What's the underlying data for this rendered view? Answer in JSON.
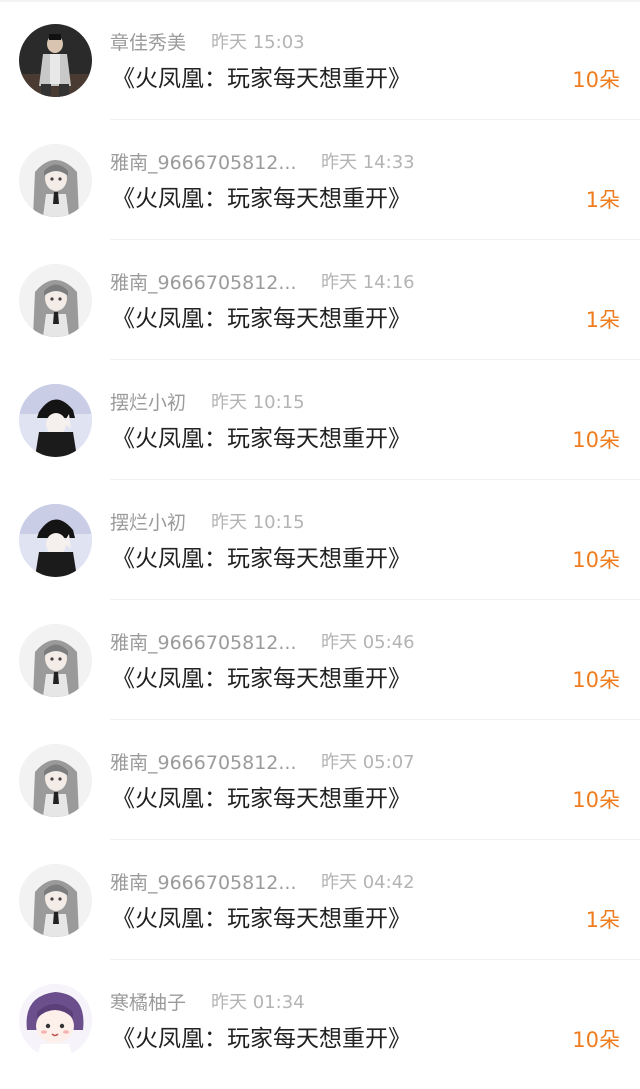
{
  "gifts": [
    {
      "user": "章佳秀美",
      "time": "昨天 15:03",
      "title": "《火凤凰：玩家每天想重开》",
      "amount": "10朵",
      "avatar": "avatar-dark-figure"
    },
    {
      "user": "雅南_9666705812...",
      "time": "昨天 14:33",
      "title": "《火凤凰：玩家每天想重开》",
      "amount": "1朵",
      "avatar": "avatar-grey-hair-girl"
    },
    {
      "user": "雅南_9666705812...",
      "time": "昨天 14:16",
      "title": "《火凤凰：玩家每天想重开》",
      "amount": "1朵",
      "avatar": "avatar-grey-hair-girl"
    },
    {
      "user": "摆烂小初",
      "time": "昨天 10:15",
      "title": "《火凤凰：玩家每天想重开》",
      "amount": "10朵",
      "avatar": "avatar-black-hat-girl"
    },
    {
      "user": "摆烂小初",
      "time": "昨天 10:15",
      "title": "《火凤凰：玩家每天想重开》",
      "amount": "10朵",
      "avatar": "avatar-black-hat-girl"
    },
    {
      "user": "雅南_9666705812...",
      "time": "昨天 05:46",
      "title": "《火凤凰：玩家每天想重开》",
      "amount": "10朵",
      "avatar": "avatar-grey-hair-girl"
    },
    {
      "user": "雅南_9666705812...",
      "time": "昨天 05:07",
      "title": "《火凤凰：玩家每天想重开》",
      "amount": "10朵",
      "avatar": "avatar-grey-hair-girl"
    },
    {
      "user": "雅南_9666705812...",
      "time": "昨天 04:42",
      "title": "《火凤凰：玩家每天想重开》",
      "amount": "1朵",
      "avatar": "avatar-grey-hair-girl"
    },
    {
      "user": "寒橘柚子",
      "time": "昨天 01:34",
      "title": "《火凤凰：玩家每天想重开》",
      "amount": "10朵",
      "avatar": "avatar-purple-hair-cartoon"
    }
  ],
  "colors": {
    "accent_amount": "#f07c1e",
    "title_text": "#222222",
    "name_text": "#9b9b9b",
    "time_text": "#b4b4b4"
  }
}
